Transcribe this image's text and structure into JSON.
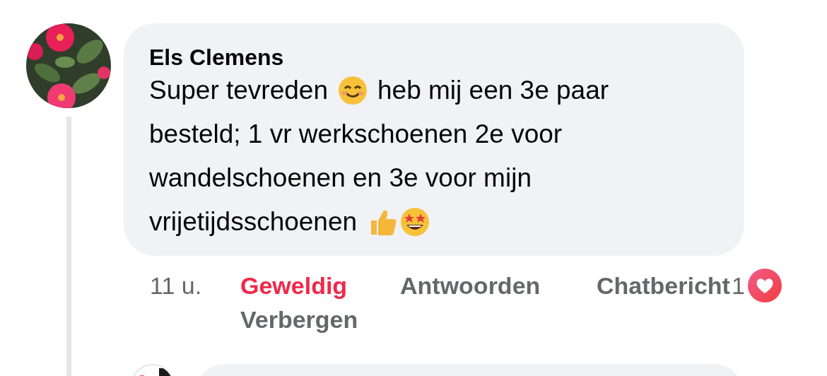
{
  "comment": {
    "author": "Els Clemens",
    "message_lines": [
      [
        {
          "kind": "text",
          "text": "Super tevreden"
        },
        {
          "kind": "smiley"
        },
        {
          "kind": "text",
          "text": "heb mij een 3e paar"
        }
      ],
      [
        {
          "kind": "text",
          "text": "besteld; 1 vr werkschoenen 2e voor"
        }
      ],
      [
        {
          "kind": "text",
          "text": "wandelschoenen en 3e voor mijn"
        }
      ],
      [
        {
          "kind": "text",
          "text": "vrijetijdsschoenen"
        },
        {
          "kind": "thumbs-up"
        },
        {
          "kind": "star-eyes"
        }
      ]
    ],
    "time": "11 u.",
    "actions": [
      {
        "label": "Geweldig",
        "selected": true
      },
      {
        "label": "Antwoorden",
        "selected": false
      },
      {
        "label": "Chatbericht",
        "selected": false
      }
    ],
    "reaction_count": "1",
    "hide_label": "Verbergen"
  }
}
